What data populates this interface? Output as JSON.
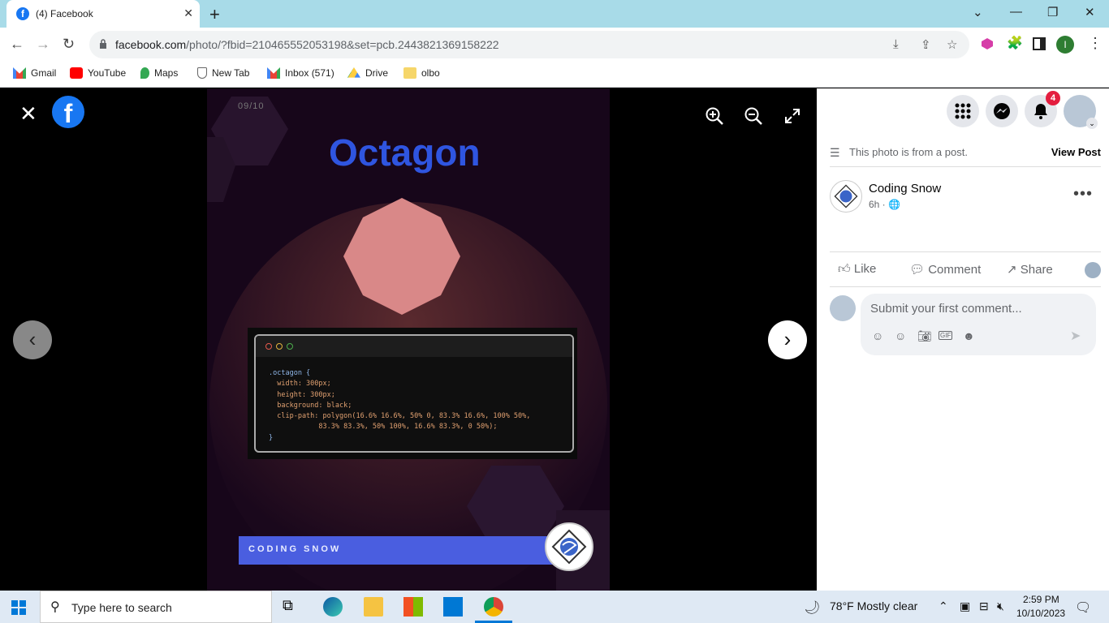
{
  "browser": {
    "tab_title": "(4) Facebook",
    "url_host": "facebook.com",
    "url_rest": "/photo/?fbid=210465552053198&set=pcb.2443821369158222",
    "bookmarks": [
      {
        "label": "Gmail",
        "icon": "gmail-icon"
      },
      {
        "label": "YouTube",
        "icon": "youtube-icon"
      },
      {
        "label": "Maps",
        "icon": "maps-icon"
      },
      {
        "label": "New Tab",
        "icon": "shield-icon"
      },
      {
        "label": "Inbox (571)",
        "icon": "gmail-icon"
      },
      {
        "label": "Drive",
        "icon": "drive-icon"
      },
      {
        "label": "olbo",
        "icon": "folder-icon"
      }
    ],
    "profile_initial": "I"
  },
  "photo": {
    "counter": "09/10",
    "title": "Octagon",
    "code_lines": [
      ".octagon {",
      "  width: 300px;",
      "  height: 300px;",
      "  background: black;",
      "  clip-path: polygon(16.6% 16.6%, 50% 0, 83.3% 16.6%, 100% 50%,",
      "            83.3% 83.3%, 50% 100%, 16.6% 83.3%, 0 50%);",
      "}"
    ],
    "banner": "CODING SNOW"
  },
  "side": {
    "notif_count": "4",
    "from_post": "This photo is from a post.",
    "view_post": "View Post",
    "author": "Coding Snow",
    "time": "6h ·",
    "actions": {
      "like": "Like",
      "comment": "Comment",
      "share": "Share"
    },
    "comment_placeholder": "Submit your first comment..."
  },
  "taskbar": {
    "search_placeholder": "Type here to search",
    "weather": "78°F  Mostly clear",
    "time": "2:59 PM",
    "date": "10/10/2023"
  },
  "colors": {
    "accent": "#1877f2",
    "title": "#2f55e0",
    "banner": "#4a5ee0",
    "octagon": "#d98888"
  }
}
